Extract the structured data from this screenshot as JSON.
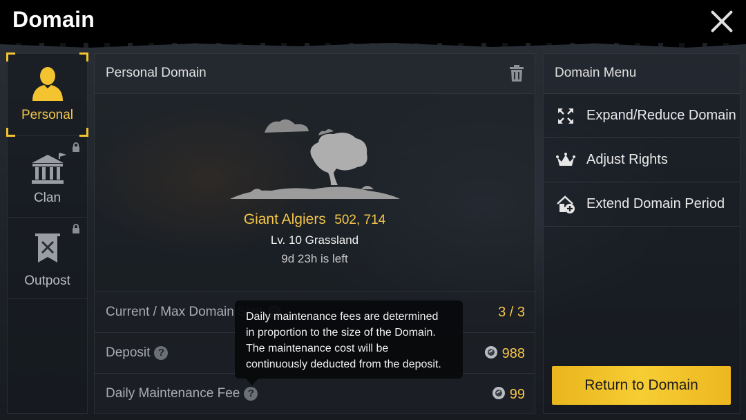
{
  "header": {
    "title": "Domain",
    "close_icon": "close-icon"
  },
  "sidebar": {
    "items": [
      {
        "label": "Personal",
        "icon": "person-icon",
        "active": true,
        "locked": false
      },
      {
        "label": "Clan",
        "icon": "temple-icon",
        "active": false,
        "locked": true
      },
      {
        "label": "Outpost",
        "icon": "banner-icon",
        "active": false,
        "locked": true
      }
    ]
  },
  "personal": {
    "header": "Personal Domain",
    "domain_name": "Giant Algiers",
    "coordinates": "502, 714",
    "level_text": "Lv. 10 Grassland",
    "time_left": "9d 23h is left",
    "rows": [
      {
        "label": "Current / Max Domain Size",
        "value": "3 / 3"
      },
      {
        "label": "Deposit",
        "value": "988"
      },
      {
        "label": "Daily Maintenance Fee",
        "value": "99"
      }
    ],
    "tooltip": [
      "Daily maintenance fees are determined",
      "in proportion to the size of the Domain.",
      "The maintenance cost will be",
      "continuously deducted from the deposit."
    ]
  },
  "menu": {
    "title": "Domain Menu",
    "items": [
      {
        "label": "Expand/Reduce Domain",
        "icon": "expand-icon"
      },
      {
        "label": "Adjust Rights",
        "icon": "crown-rights-icon"
      },
      {
        "label": "Extend Domain Period",
        "icon": "house-plus-icon"
      }
    ],
    "return_button": "Return to Domain"
  },
  "colors": {
    "accent": "#f4c430",
    "gold_text": "#f4c64a",
    "button": "#f5c62e"
  }
}
